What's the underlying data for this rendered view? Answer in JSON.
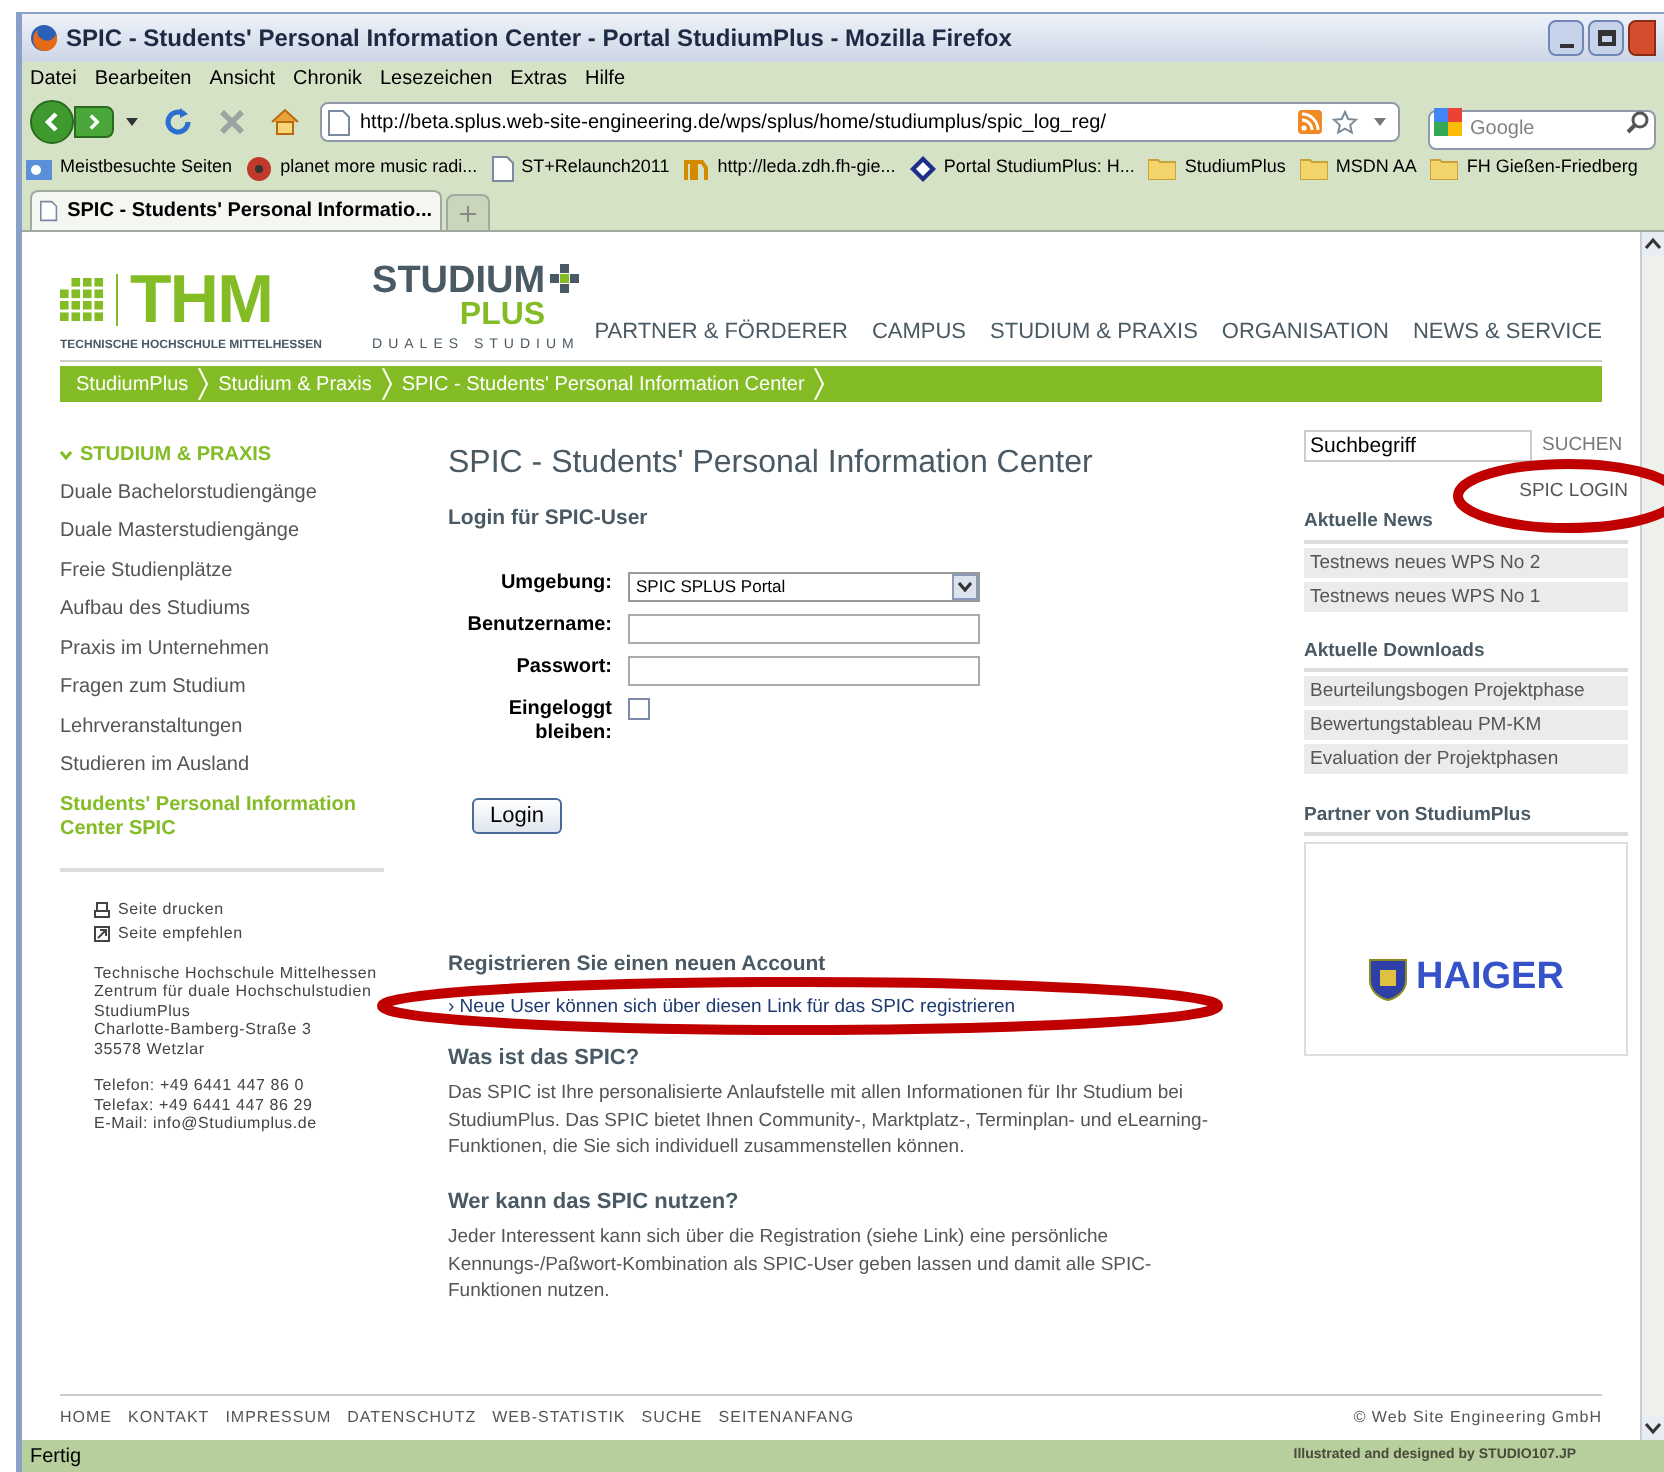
{
  "window": {
    "title": "SPIC - Students' Personal Information Center - Portal StudiumPlus - Mozilla Firefox"
  },
  "menu": [
    "Datei",
    "Bearbeiten",
    "Ansicht",
    "Chronik",
    "Lesezeichen",
    "Extras",
    "Hilfe"
  ],
  "toolbar": {
    "url": "http://beta.splus.web-site-engineering.de/wps/splus/home/studiumplus/spic_log_reg/",
    "search_placeholder": "Google"
  },
  "bookmarks": [
    {
      "label": "Meistbesuchte Seiten",
      "kind": "smart"
    },
    {
      "label": "planet more music radi...",
      "kind": "radio"
    },
    {
      "label": "ST+Relaunch2011",
      "kind": "page"
    },
    {
      "label": "http://leda.zdh.fh-gie...",
      "kind": "site"
    },
    {
      "label": "Portal StudiumPlus: H...",
      "kind": "portal"
    },
    {
      "label": "StudiumPlus",
      "kind": "folder"
    },
    {
      "label": "MSDN AA",
      "kind": "folder"
    },
    {
      "label": "FH Gießen-Friedberg",
      "kind": "folder"
    }
  ],
  "tabs": [
    {
      "label": "SPIC - Students' Personal Informatio...",
      "selected": true
    }
  ],
  "header": {
    "logo": "THM",
    "logo_subtitle": "TECHNISCHE HOCHSCHULE MITTELHESSEN",
    "brand_top": "STUDIUM",
    "brand_bottom": "PLUS",
    "brand_tagline": "DUALES STUDIUM"
  },
  "nav": [
    "PARTNER & FÖRDERER",
    "CAMPUS",
    "STUDIUM & PRAXIS",
    "ORGANISATION",
    "NEWS & SERVICE"
  ],
  "breadcrumb": [
    "StudiumPlus",
    "Studium & Praxis",
    "SPIC - Students' Personal Information Center"
  ],
  "sidebar": {
    "heading": "STUDIUM & PRAXIS",
    "items": [
      {
        "label": "Duale Bachelorstudiengänge",
        "selected": false
      },
      {
        "label": "Duale Masterstudiengänge",
        "selected": false
      },
      {
        "label": "Freie Studienplätze",
        "selected": false
      },
      {
        "label": "Aufbau des Studiums",
        "selected": false
      },
      {
        "label": "Praxis im Unternehmen",
        "selected": false
      },
      {
        "label": "Fragen zum Studium",
        "selected": false
      },
      {
        "label": "Lehrveranstaltungen",
        "selected": false
      },
      {
        "label": "Studieren im Ausland",
        "selected": false
      },
      {
        "label": "Students' Personal Information Center SPIC",
        "selected": true
      }
    ],
    "tools": [
      {
        "label": "Seite drucken",
        "kind": "print"
      },
      {
        "label": "Seite empfehlen",
        "kind": "recommend"
      }
    ],
    "address": [
      "Technische Hochschule Mittelhessen",
      "Zentrum für duale Hochschulstudien",
      "StudiumPlus",
      "Charlotte-Bamberg-Straße 3",
      "35578 Wetzlar"
    ],
    "contact": [
      "Telefon: +49 6441 447 86 0",
      "Telefax: +49 6441 447 86 29",
      "E-Mail: info@Studiumplus.de"
    ]
  },
  "main": {
    "title": "SPIC - Students' Personal Information Center",
    "login_heading": "Login für SPIC-User",
    "fields": [
      {
        "label": "Umgebung:",
        "kind": "select",
        "value": "SPIC SPLUS Portal"
      },
      {
        "label": "Benutzername:",
        "kind": "text"
      },
      {
        "label": "Passwort:",
        "kind": "password"
      },
      {
        "label": "Eingeloggt bleiben:",
        "kind": "checkbox",
        "checked": false
      }
    ],
    "login_button": "Login",
    "register_heading": "Registrieren Sie einen neuen Account",
    "register_link": "› Neue User können sich über diesen Link für das SPIC registrieren",
    "sections": [
      {
        "heading": "Was ist das SPIC?",
        "text": "Das SPIC ist Ihre personalisierte Anlaufstelle mit allen Informationen für Ihr Studium bei StudiumPlus. Das SPIC bietet Ihnen Community-, Marktplatz-, Terminplan- und eLearning-Funktionen, die Sie sich individuell zusammenstellen können."
      },
      {
        "heading": "Wer kann das SPIC nutzen?",
        "text": "Jeder Interessent kann sich über die Registration (siehe Link) eine persönliche Kennungs-/Paßwort-Kombination als SPIC-User geben lassen und damit alle SPIC-Funktionen nutzen."
      }
    ]
  },
  "right": {
    "search_value": "Suchbegriff",
    "search_button": "SUCHEN",
    "login_link": "SPIC LOGIN",
    "news_heading": "Aktuelle News",
    "news": [
      "Testnews neues WPS No 2",
      "Testnews neues WPS No 1"
    ],
    "downloads_heading": "Aktuelle Downloads",
    "downloads": [
      "Beurteilungsbogen Projektphase",
      "Bewertungstableau PM-KM",
      "Evaluation der Projektphasen"
    ],
    "partner_heading": "Partner von StudiumPlus",
    "partner_logo": "HAIGER"
  },
  "footer": {
    "links": [
      "HOME",
      "KONTAKT",
      "IMPRESSUM",
      "DATENSCHUTZ",
      "WEB-STATISTIK",
      "SUCHE",
      "SEITENANFANG"
    ],
    "copyright": "© Web Site Engineering GmbH"
  },
  "status_bar": {
    "text": "Fertig",
    "credit": "Illustrated and designed by STUDIO107.JP"
  }
}
